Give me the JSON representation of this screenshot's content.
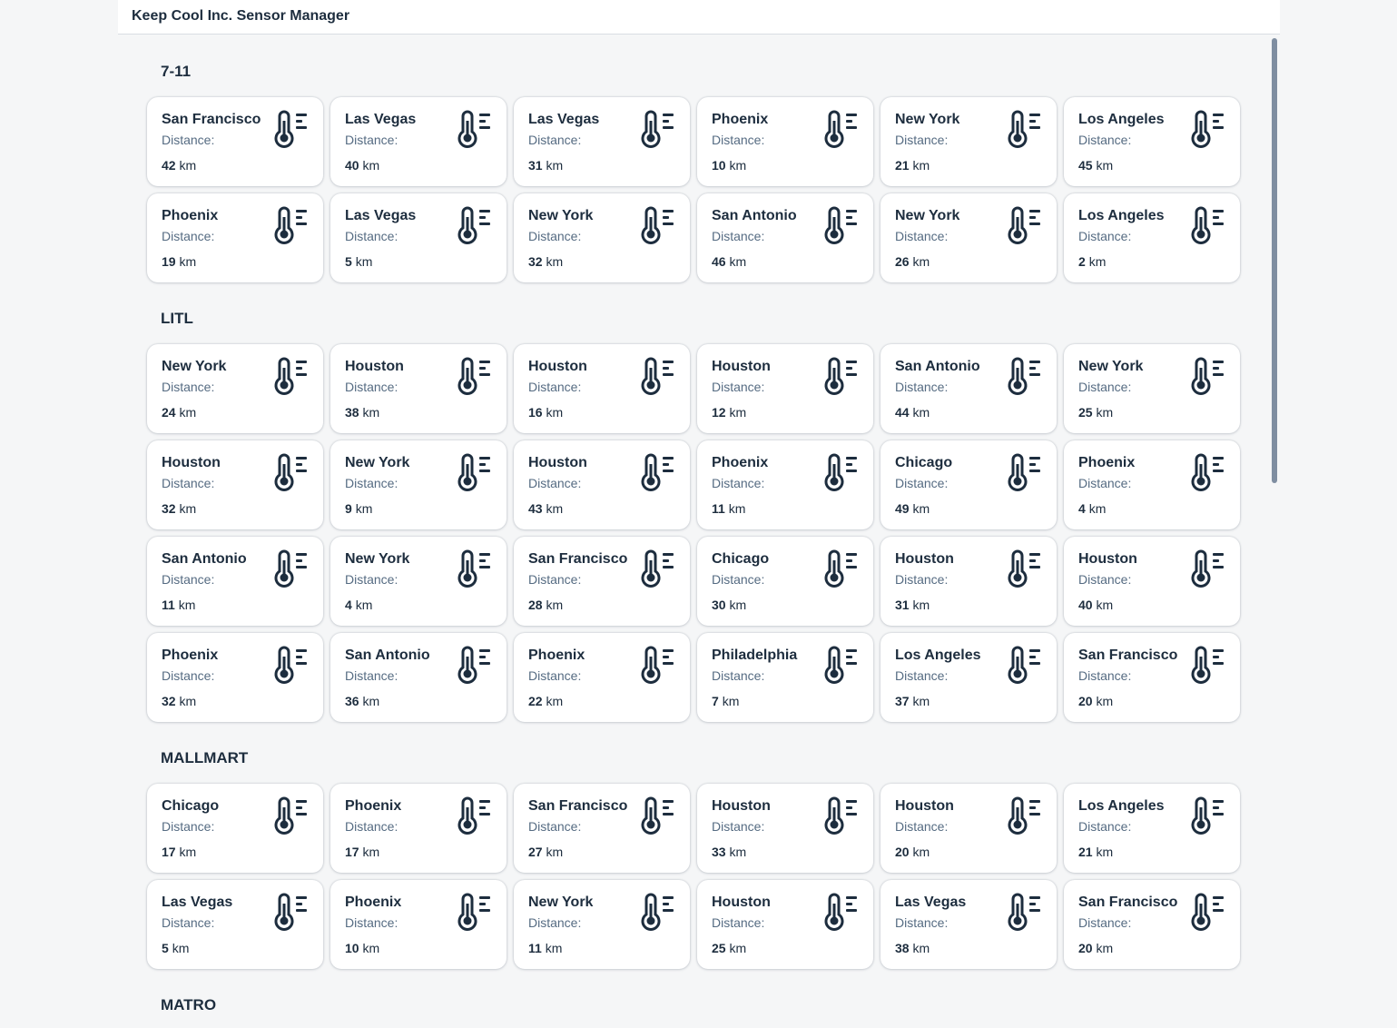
{
  "app": {
    "title": "Keep Cool Inc. Sensor Manager"
  },
  "labels": {
    "distance": "Distance:",
    "unit": "km"
  },
  "icon": "thermometer-icon",
  "groups": [
    {
      "name": "7-11",
      "sensors": [
        {
          "city": "San Francisco",
          "distance": "42"
        },
        {
          "city": "Las Vegas",
          "distance": "40"
        },
        {
          "city": "Las Vegas",
          "distance": "31"
        },
        {
          "city": "Phoenix",
          "distance": "10"
        },
        {
          "city": "New York",
          "distance": "21"
        },
        {
          "city": "Los Angeles",
          "distance": "45"
        },
        {
          "city": "Phoenix",
          "distance": "19"
        },
        {
          "city": "Las Vegas",
          "distance": "5"
        },
        {
          "city": "New York",
          "distance": "32"
        },
        {
          "city": "San Antonio",
          "distance": "46"
        },
        {
          "city": "New York",
          "distance": "26"
        },
        {
          "city": "Los Angeles",
          "distance": "2"
        }
      ]
    },
    {
      "name": "LITL",
      "sensors": [
        {
          "city": "New York",
          "distance": "24"
        },
        {
          "city": "Houston",
          "distance": "38"
        },
        {
          "city": "Houston",
          "distance": "16"
        },
        {
          "city": "Houston",
          "distance": "12"
        },
        {
          "city": "San Antonio",
          "distance": "44"
        },
        {
          "city": "New York",
          "distance": "25"
        },
        {
          "city": "Houston",
          "distance": "32"
        },
        {
          "city": "New York",
          "distance": "9"
        },
        {
          "city": "Houston",
          "distance": "43"
        },
        {
          "city": "Phoenix",
          "distance": "11"
        },
        {
          "city": "Chicago",
          "distance": "49"
        },
        {
          "city": "Phoenix",
          "distance": "4"
        },
        {
          "city": "San Antonio",
          "distance": "11"
        },
        {
          "city": "New York",
          "distance": "4"
        },
        {
          "city": "San Francisco",
          "distance": "28"
        },
        {
          "city": "Chicago",
          "distance": "30"
        },
        {
          "city": "Houston",
          "distance": "31"
        },
        {
          "city": "Houston",
          "distance": "40"
        },
        {
          "city": "Phoenix",
          "distance": "32"
        },
        {
          "city": "San Antonio",
          "distance": "36"
        },
        {
          "city": "Phoenix",
          "distance": "22"
        },
        {
          "city": "Philadelphia",
          "distance": "7"
        },
        {
          "city": "Los Angeles",
          "distance": "37"
        },
        {
          "city": "San Francisco",
          "distance": "20"
        }
      ]
    },
    {
      "name": "MALLMART",
      "sensors": [
        {
          "city": "Chicago",
          "distance": "17"
        },
        {
          "city": "Phoenix",
          "distance": "17"
        },
        {
          "city": "San Francisco",
          "distance": "27"
        },
        {
          "city": "Houston",
          "distance": "33"
        },
        {
          "city": "Houston",
          "distance": "20"
        },
        {
          "city": "Los Angeles",
          "distance": "21"
        },
        {
          "city": "Las Vegas",
          "distance": "5"
        },
        {
          "city": "Phoenix",
          "distance": "10"
        },
        {
          "city": "New York",
          "distance": "11"
        },
        {
          "city": "Houston",
          "distance": "25"
        },
        {
          "city": "Las Vegas",
          "distance": "38"
        },
        {
          "city": "San Francisco",
          "distance": "20"
        }
      ]
    },
    {
      "name": "MATRO",
      "sensors": []
    }
  ]
}
